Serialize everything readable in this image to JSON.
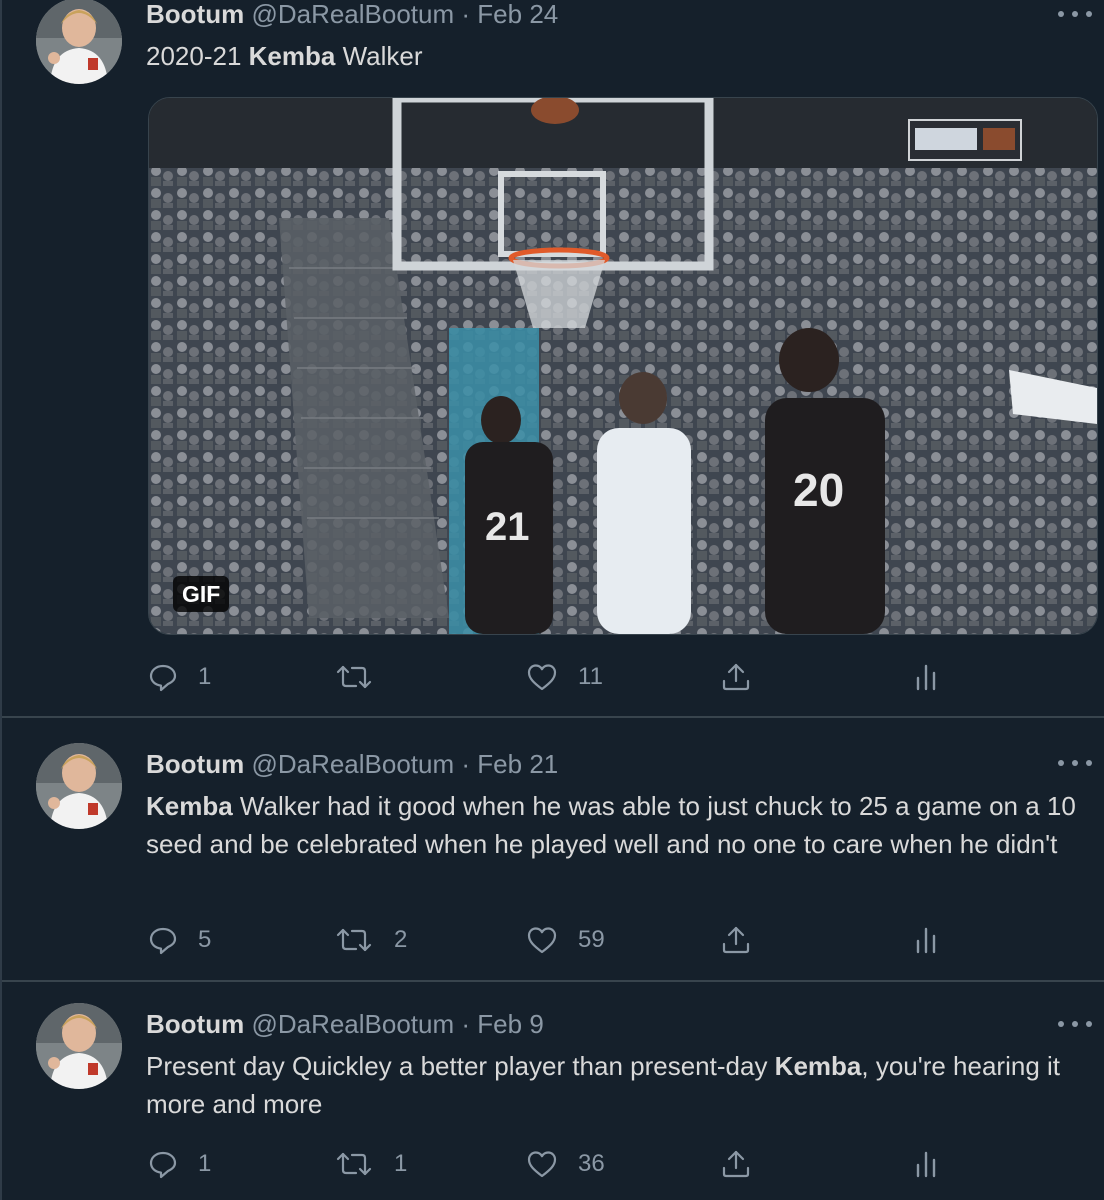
{
  "tweets": [
    {
      "author": {
        "name": "Bootum",
        "handle": "@DaRealBootum"
      },
      "separator": "·",
      "date": "Feb 24",
      "text": {
        "before": "2020-21 ",
        "bold": "Kemba",
        "after": " Walker"
      },
      "media": {
        "type": "gif",
        "badge": "GIF",
        "jerseys": [
          "21",
          "20"
        ]
      },
      "actions": {
        "replies": "1",
        "retweets": "",
        "likes": "11"
      }
    },
    {
      "author": {
        "name": "Bootum",
        "handle": "@DaRealBootum"
      },
      "separator": "·",
      "date": "Feb 21",
      "text": {
        "before": "",
        "bold": "Kemba",
        "after": " Walker had it good when he was able to just chuck to 25 a game on a 10 seed and be celebrated when he played well and no one to care when he didn't"
      },
      "actions": {
        "replies": "5",
        "retweets": "2",
        "likes": "59"
      }
    },
    {
      "author": {
        "name": "Bootum",
        "handle": "@DaRealBootum"
      },
      "separator": "·",
      "date": "Feb 9",
      "text": {
        "before": "Present day Quickley a better player than present-day ",
        "bold": "Kemba",
        "after": ", you're hearing it more and more"
      },
      "actions": {
        "replies": "1",
        "retweets": "1",
        "likes": "36"
      }
    }
  ],
  "icons": [
    "avatar",
    "more-icon",
    "reply-icon",
    "retweet-icon",
    "like-icon",
    "share-icon",
    "analytics-icon"
  ],
  "colors": {
    "background": "#15202b",
    "text": "#d9d9d9",
    "muted": "#8b98a5",
    "divider": "#38444d"
  }
}
